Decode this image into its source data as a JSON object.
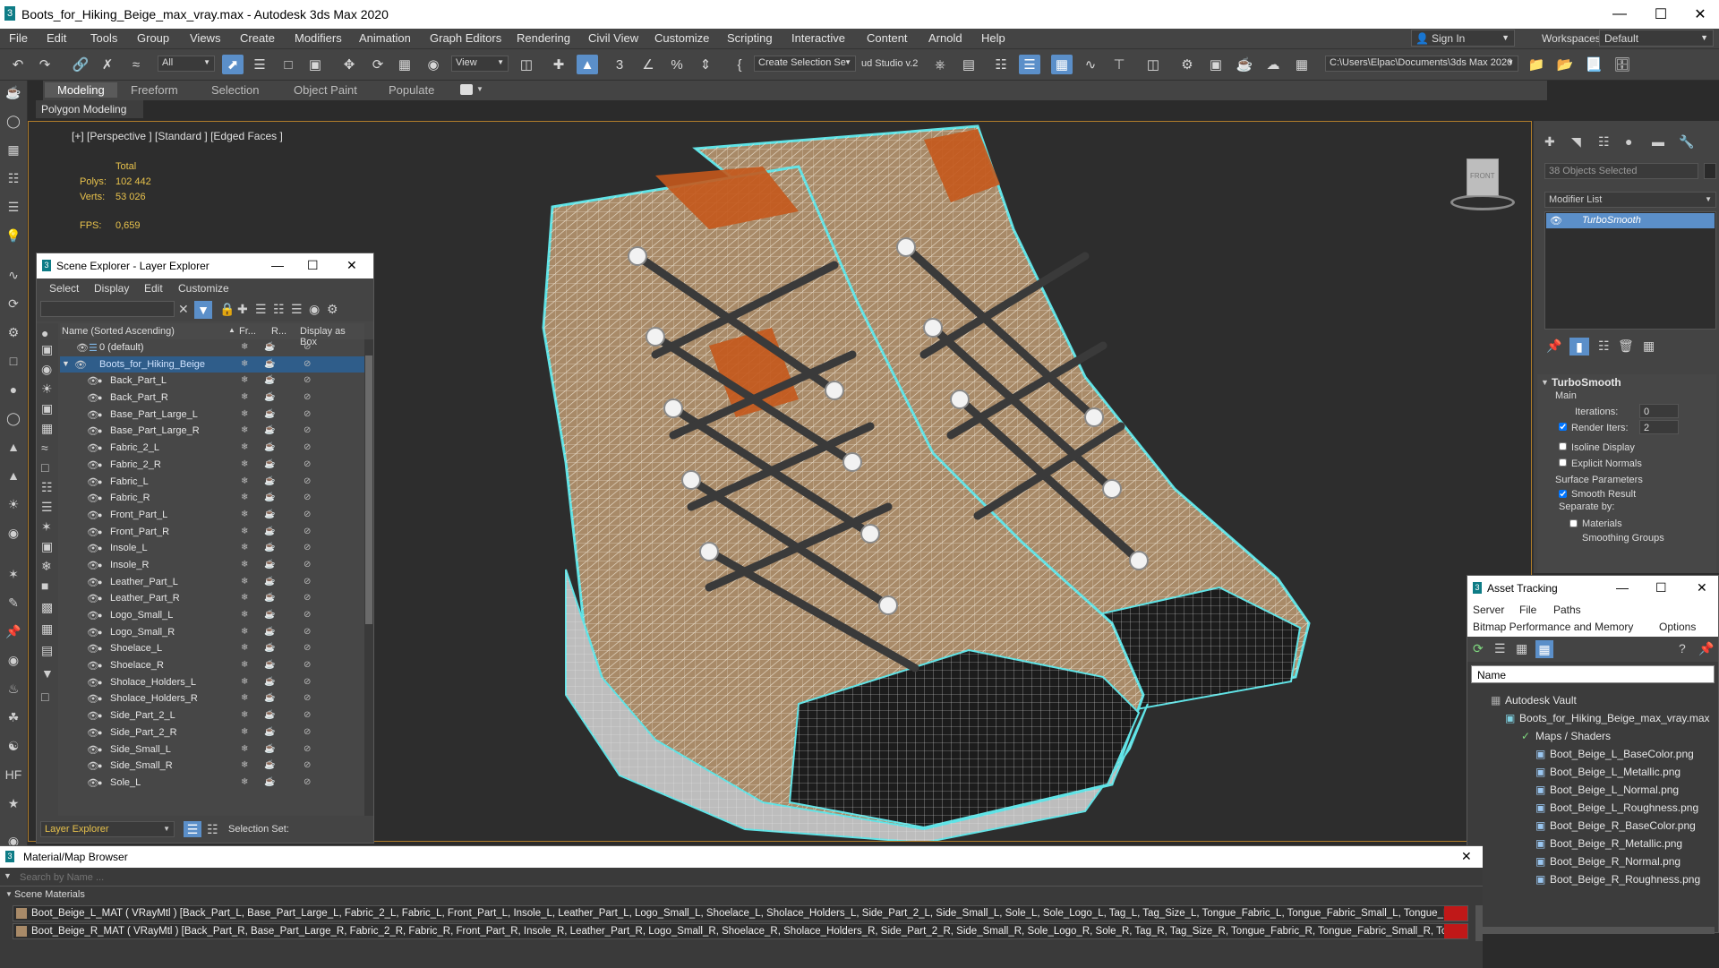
{
  "window": {
    "title": "Boots_for_Hiking_Beige_max_vray.max - Autodesk 3ds Max 2020"
  },
  "menu": [
    "File",
    "Edit",
    "Tools",
    "Group",
    "Views",
    "Create",
    "Modifiers",
    "Animation",
    "Graph Editors",
    "Rendering",
    "Civil View",
    "Customize",
    "Scripting",
    "Interactive",
    "Content",
    "Arnold",
    "Help"
  ],
  "account": {
    "sign_in": "Sign In",
    "workspaces_label": "Workspaces:",
    "workspace": "Default"
  },
  "toolbar": {
    "filter": "All",
    "view": "View",
    "selection_set": "Create Selection Se",
    "studio": "ud Studio v.2",
    "project_path": "C:\\Users\\Elpac\\Documents\\3ds Max 2020"
  },
  "ribbon": {
    "tabs": [
      "Modeling",
      "Freeform",
      "Selection",
      "Object Paint",
      "Populate"
    ],
    "sub": "Polygon Modeling"
  },
  "viewport": {
    "label": "[+] [Perspective ] [Standard ] [Edged Faces ]",
    "stats_total": "Total",
    "polys_label": "Polys:",
    "polys": "102 442",
    "verts_label": "Verts:",
    "verts": "53 026",
    "fps_label": "FPS:",
    "fps": "0,659",
    "gizmo": "FRONT"
  },
  "command_panel": {
    "selected": "38 Objects Selected",
    "modifier_list": "Modifier List",
    "modifier": "TurboSmooth",
    "rollout": "TurboSmooth",
    "main": "Main",
    "iterations_label": "Iterations:",
    "iterations": "0",
    "render_iters_label": "Render Iters:",
    "render_iters": "2",
    "isoline": "Isoline Display",
    "explicit": "Explicit Normals",
    "surface": "Surface Parameters",
    "smooth_result": "Smooth Result",
    "separate": "Separate by:",
    "materials": "Materials",
    "smoothing": "Smoothing Groups"
  },
  "scene_explorer": {
    "title": "Scene Explorer - Layer Explorer",
    "menus": [
      "Select",
      "Display",
      "Edit",
      "Customize"
    ],
    "col_name": "Name (Sorted Ascending)",
    "col_fr": "Fr...",
    "col_r": "R...",
    "col_box": "Display as Box",
    "layer_default": "0 (default)",
    "group": "Boots_for_Hiking_Beige",
    "items": [
      "Back_Part_L",
      "Back_Part_R",
      "Base_Part_Large_L",
      "Base_Part_Large_R",
      "Fabric_2_L",
      "Fabric_2_R",
      "Fabric_L",
      "Fabric_R",
      "Front_Part_L",
      "Front_Part_R",
      "Insole_L",
      "Insole_R",
      "Leather_Part_L",
      "Leather_Part_R",
      "Logo_Small_L",
      "Logo_Small_R",
      "Shoelace_L",
      "Shoelace_R",
      "Sholace_Holders_L",
      "Sholace_Holders_R",
      "Side_Part_2_L",
      "Side_Part_2_R",
      "Side_Small_L",
      "Side_Small_R",
      "Sole_L"
    ],
    "footer_explorer": "Layer Explorer",
    "footer_selset": "Selection Set:"
  },
  "asset_tracking": {
    "title": "Asset Tracking",
    "menus": [
      "Server",
      "File",
      "Paths"
    ],
    "menus2": [
      "Bitmap Performance and Memory",
      "Options"
    ],
    "col_name": "Name",
    "vault": "Autodesk Vault",
    "file": "Boots_for_Hiking_Beige_max_vray.max",
    "maps": "Maps / Shaders",
    "textures": [
      "Boot_Beige_L_BaseColor.png",
      "Boot_Beige_L_Metallic.png",
      "Boot_Beige_L_Normal.png",
      "Boot_Beige_L_Roughness.png",
      "Boot_Beige_R_BaseColor.png",
      "Boot_Beige_R_Metallic.png",
      "Boot_Beige_R_Normal.png",
      "Boot_Beige_R_Roughness.png"
    ]
  },
  "material_browser": {
    "title": "Material/Map Browser",
    "search": "Search by Name ...",
    "section": "Scene Materials",
    "materials": [
      "Boot_Beige_L_MAT  ( VRayMtl ) [Back_Part_L, Base_Part_Large_L, Fabric_2_L, Fabric_L, Front_Part_L, Insole_L, Leather_Part_L, Logo_Small_L, Shoelace_L, Sholace_Holders_L, Side_Part_2_L, Side_Small_L, Sole_L, Sole_Logo_L, Tag_L, Tag_Size_L, Tongue_Fabric_L, Tongue_Fabric_Small_L, Tongue_Leathrer_L]",
      "Boot_Beige_R_MAT  ( VRayMtl ) [Back_Part_R, Base_Part_Large_R, Fabric_2_R, Fabric_R, Front_Part_R, Insole_R, Leather_Part_R, Logo_Small_R, Shoelace_R, Sholace_Holders_R, Side_Part_2_R, Side_Small_R, Sole_Logo_R, Sole_R, Tag_R, Tag_Size_R, Tongue_Fabric_R, Tongue_Fabric_Small_R, Tongue_Leathrer_R]"
    ]
  },
  "colors": {
    "accent": "#5b8fc9",
    "viewport_border": "#b07d2a",
    "wire": "#e8e2d6",
    "outline": "#5fe3e6",
    "leather": "#a88a68",
    "rubber": "#1c1c1c",
    "orange": "#c4581c"
  }
}
